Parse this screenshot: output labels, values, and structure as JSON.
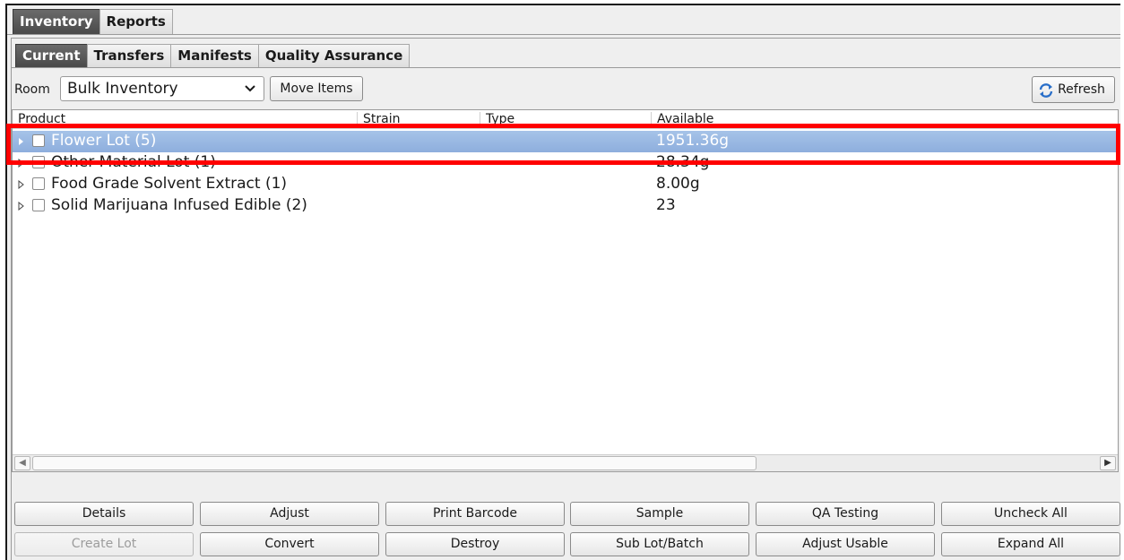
{
  "top_tabs": [
    {
      "label": "Inventory",
      "active": true
    },
    {
      "label": "Reports",
      "active": false
    }
  ],
  "sub_tabs": [
    {
      "label": "Current",
      "active": true
    },
    {
      "label": "Transfers",
      "active": false
    },
    {
      "label": "Manifests",
      "active": false
    },
    {
      "label": "Quality Assurance",
      "active": false
    }
  ],
  "toolbar": {
    "room_label": "Room",
    "room_value": "Bulk Inventory",
    "move_items_label": "Move Items",
    "refresh_label": "Refresh"
  },
  "table": {
    "columns": [
      "Product",
      "Strain",
      "Type",
      "Available"
    ],
    "rows": [
      {
        "name": "Flower Lot (5)",
        "available": "1951.36g",
        "selected": true
      },
      {
        "name": "Other Material Lot (1)",
        "available": "28.34g",
        "selected": false
      },
      {
        "name": "Food Grade Solvent Extract (1)",
        "available": "8.00g",
        "selected": false
      },
      {
        "name": "Solid Marijuana Infused Edible (2)",
        "available": "23",
        "selected": false
      }
    ]
  },
  "actions_row1": [
    "Details",
    "Adjust",
    "Print Barcode",
    "Sample",
    "QA Testing",
    "Uncheck All"
  ],
  "actions_row2": [
    "Create Lot",
    "Convert",
    "Destroy",
    "Sub Lot/Batch",
    "Adjust Usable",
    "Expand All"
  ],
  "colors": {
    "selection": "#95b4e0",
    "highlight_box": "#ff0000"
  }
}
